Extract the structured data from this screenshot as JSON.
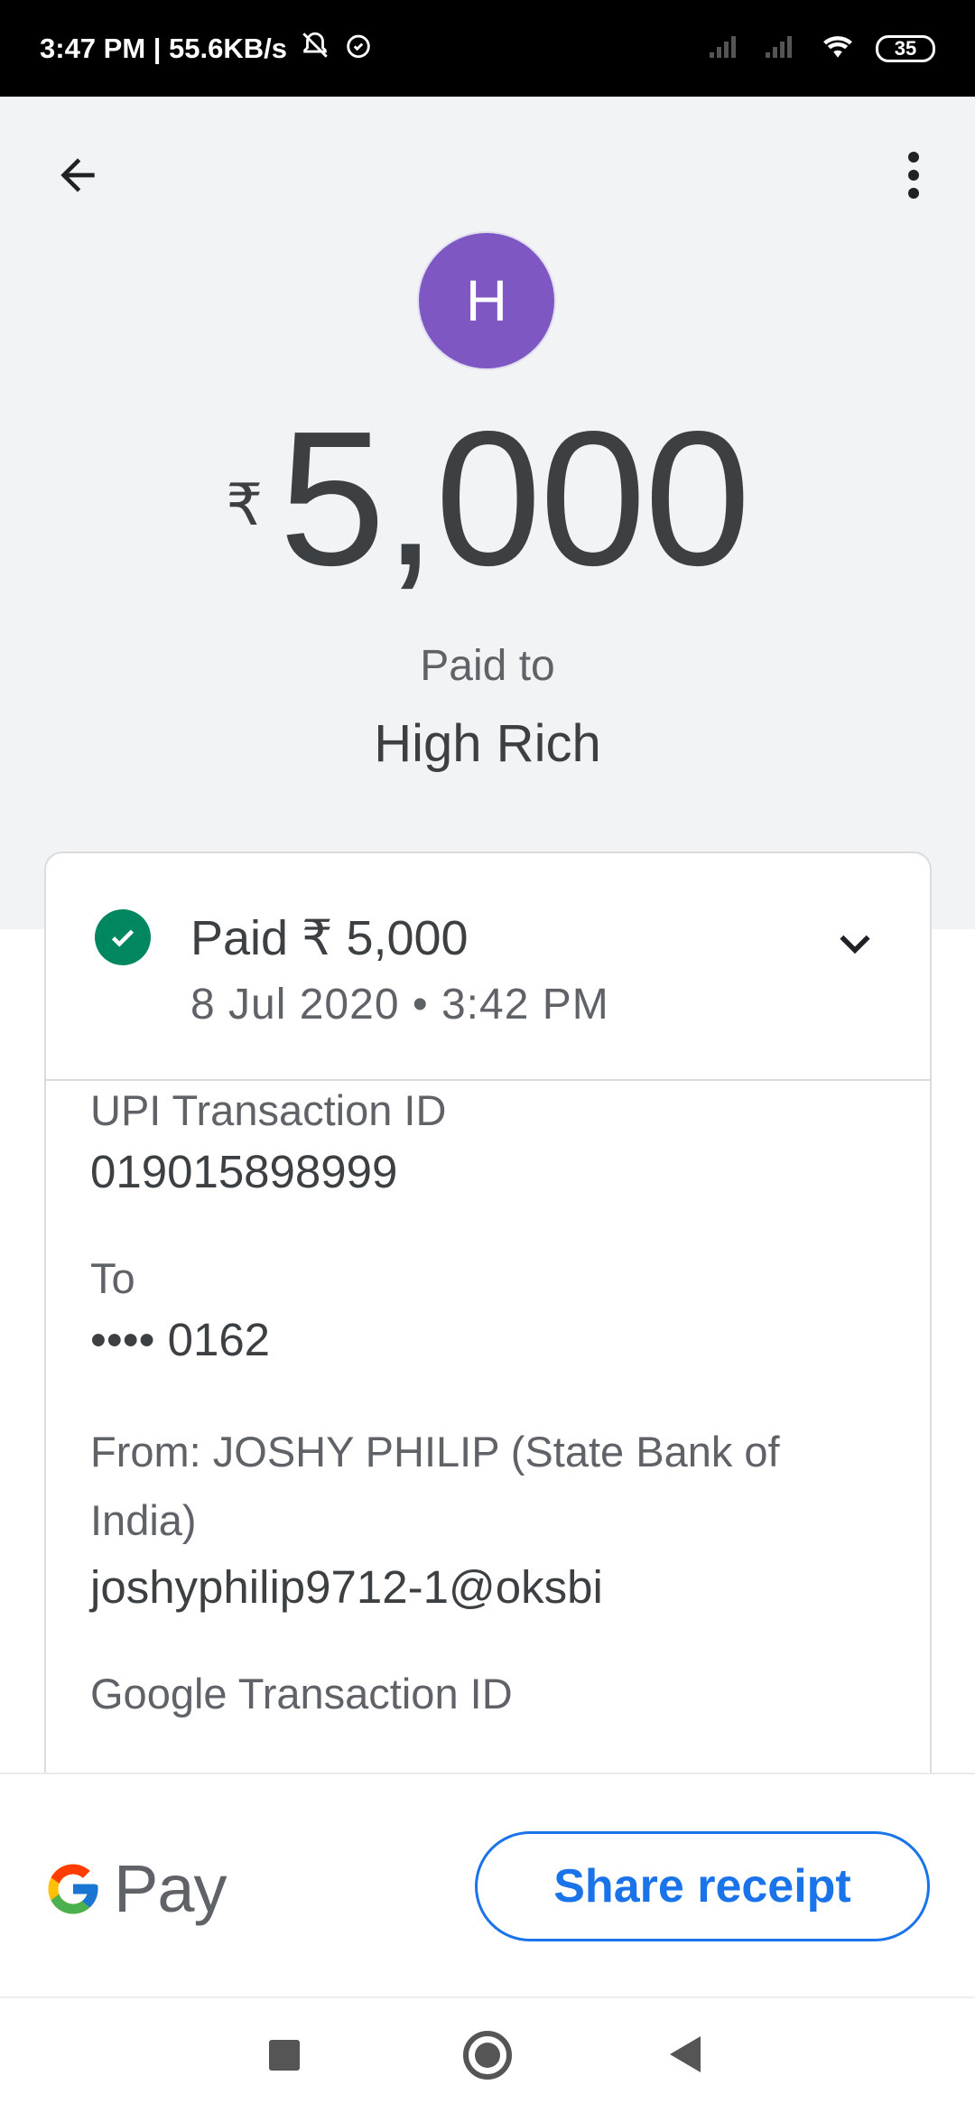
{
  "status_bar": {
    "time_speed": "3:47 PM | 55.6KB/s",
    "battery": "35",
    "icons": [
      "mute-icon",
      "alarm-icon",
      "signal-icon",
      "signal-icon",
      "wifi-icon",
      "battery-icon"
    ]
  },
  "header": {
    "avatar_letter": "H",
    "avatar_color": "#7e57c2",
    "currency_symbol": "₹",
    "amount": "5,000",
    "paid_to_label": "Paid to",
    "payee_name": "High Rich"
  },
  "summary": {
    "title": "Paid ₹ 5,000",
    "date": "8 Jul 2020 • 3:42 PM",
    "status_color": "#01875f"
  },
  "details": [
    {
      "label": "UPI Transaction ID",
      "value": "019015898999"
    },
    {
      "label": "To",
      "value": "•••• 0162"
    },
    {
      "label": "From: JOSHY  PHILIP (State Bank of India)",
      "value": "joshyphilip9712-1@oksbi"
    },
    {
      "label": "Google Transaction ID",
      "value": ""
    }
  ],
  "footer": {
    "brand_text": "Pay",
    "share_label": "Share receipt",
    "accent": "#1a73e8"
  }
}
